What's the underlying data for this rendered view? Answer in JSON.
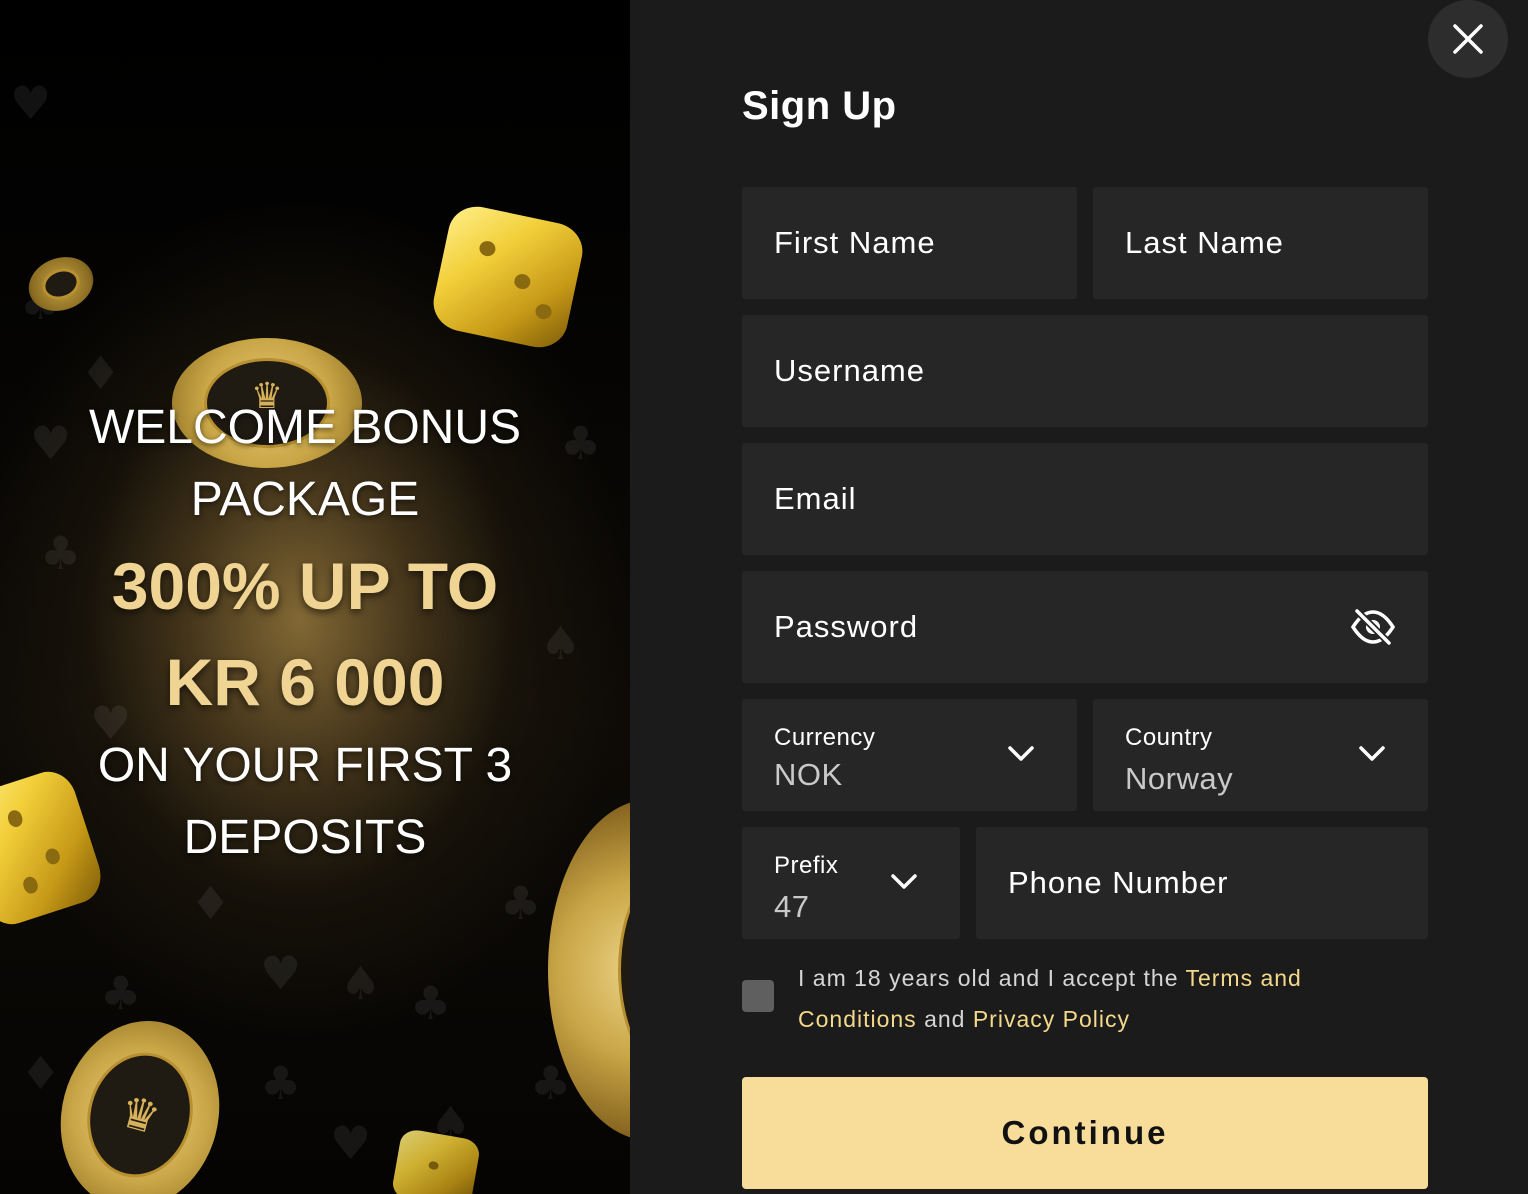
{
  "promo": {
    "line1": "WELCOME BONUS",
    "line2": "PACKAGE",
    "amount_line1": "300% UP TO",
    "amount_line2": "KR 6 000",
    "line3": "ON YOUR FIRST 3",
    "line4": "DEPOSITS"
  },
  "form": {
    "title": "Sign Up",
    "first_name_placeholder": "First Name",
    "last_name_placeholder": "Last Name",
    "username_placeholder": "Username",
    "email_placeholder": "Email",
    "password_placeholder": "Password",
    "currency": {
      "label": "Currency",
      "value": "NOK"
    },
    "country": {
      "label": "Country",
      "value": "Norway"
    },
    "prefix": {
      "label": "Prefix",
      "value": "47"
    },
    "phone_placeholder": "Phone Number",
    "agree": {
      "text_before": "I am 18 years old and I accept the ",
      "terms_link": "Terms and Conditions",
      "text_middle": " and ",
      "privacy_link": "Privacy Policy"
    },
    "continue_label": "Continue"
  },
  "icons": {
    "close": "close-icon",
    "password_visibility": "eye-off-icon",
    "dropdown": "chevron-down-icon"
  },
  "colors": {
    "panel_background": "#1b1b1b",
    "field_background": "#262626",
    "accent_gold": "#f5d98a",
    "button_background": "#f8dc9a"
  }
}
